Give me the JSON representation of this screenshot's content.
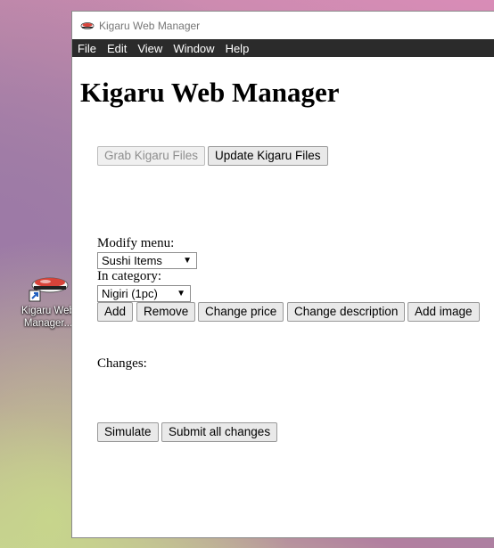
{
  "desktop": {
    "shortcut_label_line1": "Kigaru Web",
    "shortcut_label_line2": "Manager..."
  },
  "window": {
    "title": "Kigaru Web Manager",
    "menu": [
      "File",
      "Edit",
      "View",
      "Window",
      "Help"
    ]
  },
  "page": {
    "heading": "Kigaru Web Manager",
    "grab_label": "Grab Kigaru Files",
    "update_label": "Update Kigaru Files",
    "modify_menu_label": "Modify menu:",
    "menu_select_value": "Sushi Items",
    "in_category_label": "In category:",
    "category_select_value": "Nigiri (1pc)",
    "actions": [
      "Add",
      "Remove",
      "Change price",
      "Change description",
      "Add image"
    ],
    "changes_label": "Changes:",
    "simulate_label": "Simulate",
    "submit_label": "Submit all changes"
  },
  "icons": {
    "caret": "▼"
  }
}
